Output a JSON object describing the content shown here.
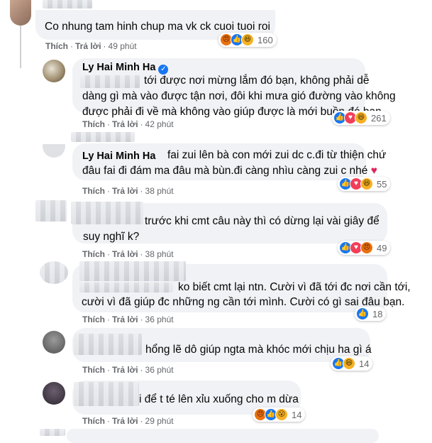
{
  "labels": {
    "like": "Thích",
    "reply": "Trả lời"
  },
  "comments": [
    {
      "name": "",
      "text_lines": [
        "Co nhung tam hinh chup ma vk ck cuoi tuoi roi"
      ],
      "time": "49 phút",
      "reaction_count": "160"
    },
    {
      "name": "Ly Hai Minh Ha",
      "text_lines": [
        "tới được nơi mừng lắm đó bạn, không phải dễ",
        "dàng gì mà vào được tận nơi, đôi khi mưa gió đường vào không",
        "được phải đi về mà không vào giúp được là mới buồn đó bạn."
      ],
      "time": "42 phút",
      "reaction_count": "261"
    },
    {
      "name": "Ly Hai Minh Ha",
      "text_lines": [
        "fai zui lên bà con mới zui dc c.đi từ thiện chứ",
        "đâu fai đi đám ma đâu mà bùn.đi càng nhìu càng zui c nhé"
      ],
      "heart": "♥",
      "time": "38 phút",
      "reaction_count": "55"
    },
    {
      "name": "",
      "text_lines": [
        "trước khi cmt câu này thì có dừng lại vài giây để",
        "suy nghĩ k?"
      ],
      "time": "38 phút",
      "reaction_count": "49"
    },
    {
      "name": "",
      "text_lines": [
        "ko biết cmt lại ntn. Cười vì đã tới đc nơi cần tới,",
        "cười vì đã giúp đc những ng cần tới mình. Cười có gì sai đâu bạn."
      ],
      "time": "36 phút",
      "reaction_count": "18"
    },
    {
      "name": "",
      "text_lines": [
        "hổng lẽ dô giúp ngta mà khóc mới chịu ha gì á"
      ],
      "time": "36 phút",
      "reaction_count": "14"
    },
    {
      "name": "",
      "text_lines": [
        "i để t té lên xỉu xuống cho m dừa"
      ],
      "time": "29 phút",
      "reaction_count": "14"
    }
  ]
}
